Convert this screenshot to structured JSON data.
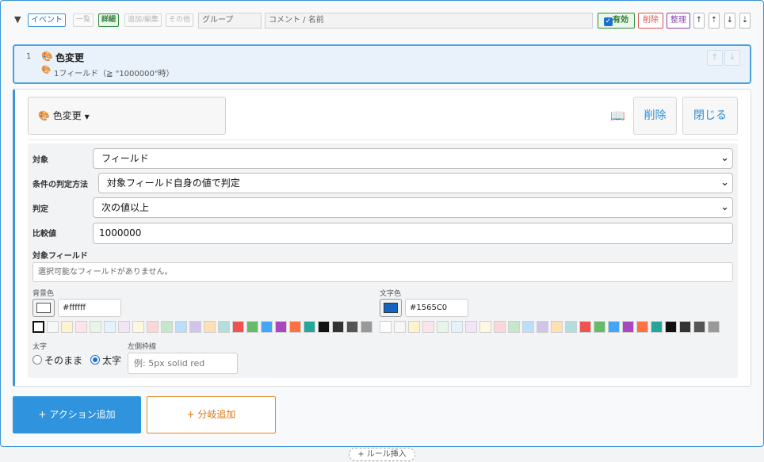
{
  "header": {
    "collapse_glyph": "▼",
    "tags": [
      "イベント",
      "一覧",
      "詳細",
      "追加/編集",
      "その他"
    ],
    "group_placeholder": "グループ",
    "comment_placeholder": "コメント / 名前",
    "enabled_label": "有効",
    "delete_label": "削除",
    "organize_label": "整理",
    "arrows": [
      "↑",
      "⇡",
      "↓",
      "⇣"
    ]
  },
  "rule": {
    "index": "1",
    "title": "色変更",
    "summary": "1フィールド（≧ \"1000000\"時）",
    "arrows": [
      "↑",
      "↓"
    ]
  },
  "action": {
    "type_button": "色変更",
    "book_icon": "book-icon",
    "delete_label": "削除",
    "close_label": "閉じる",
    "fields": {
      "target_label": "対象",
      "target_value": "フィールド",
      "method_label": "条件の判定方法",
      "method_value": "対象フィールド自身の値で判定",
      "judge_label": "判定",
      "judge_value": "次の値以上",
      "compare_label": "比較値",
      "compare_value": "1000000",
      "target_field_label": "対象フィールド",
      "target_field_note": "選択可能なフィールドがありません。"
    },
    "bg_color": {
      "label": "背景色",
      "value": "#ffffff"
    },
    "text_color": {
      "label": "文字色",
      "value": "#1565C0"
    },
    "palette": [
      "#ffffff",
      "#f7f7f7",
      "#fff3cd",
      "#fde4ec",
      "#e8f5e9",
      "#e3f2fd",
      "#f3e5f5",
      "#fff8e1",
      "#fbd7da",
      "#c8e6c9",
      "#bbdefb",
      "#d1c4e9",
      "#ffe0b2",
      "#b2dfdb",
      "#ef5350",
      "#66bb6a",
      "#42a5f5",
      "#ab47bc",
      "#ff7043",
      "#26a69a",
      "#111111",
      "#333333",
      "#555555",
      "#999999"
    ],
    "bold": {
      "label": "太字",
      "option_keep": "そのまま",
      "option_bold": "太字"
    },
    "left_border": {
      "label": "左側枠線",
      "placeholder": "例: 5px solid red"
    }
  },
  "footer": {
    "add_action": "+ アクション追加",
    "add_branch": "+ 分岐追加",
    "insert_rule": "+ ルール挿入"
  }
}
